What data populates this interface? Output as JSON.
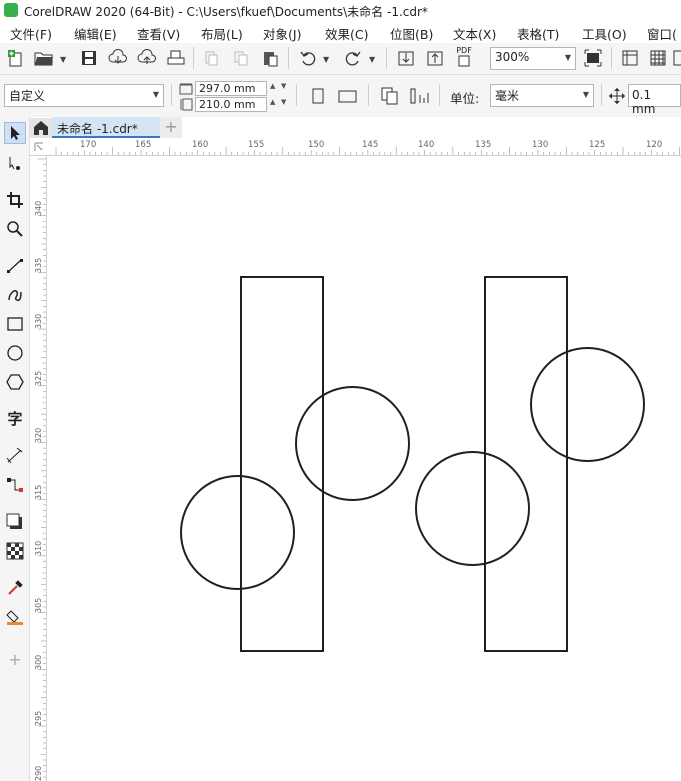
{
  "app": {
    "title": "CorelDRAW 2020 (64-Bit) - C:\\Users\\fkuef\\Documents\\未命名 -1.cdr*"
  },
  "menu": [
    "文件(F)",
    "编辑(E)",
    "查看(V)",
    "布局(L)",
    "对象(J)",
    "效果(C)",
    "位图(B)",
    "文本(X)",
    "表格(T)",
    "工具(O)",
    "窗口("
  ],
  "toolbar": {
    "pdf_label": "PDF",
    "zoom_value": "300%"
  },
  "property_bar": {
    "page_preset": "自定义",
    "page_width": "297.0 mm",
    "page_height": "210.0 mm",
    "units_label": "单位:",
    "units_value": "毫米",
    "nudge_value": "0.1 mm"
  },
  "document_tab": {
    "name": "未命名 -1.cdr*"
  },
  "ruler": {
    "horizontal": [
      "170",
      "165",
      "160",
      "155",
      "150",
      "145",
      "140",
      "135",
      "130",
      "125",
      "120"
    ],
    "vertical": [
      "340",
      "335",
      "330",
      "325",
      "320",
      "315",
      "310",
      "305",
      "300",
      "295",
      "290"
    ]
  },
  "toolbox": {
    "text_tool_glyph": "字"
  },
  "colors": {
    "app_icon": "#35b04a",
    "tab_active": "#d4e4f4",
    "tab_accent": "#3a78c2",
    "shape_stroke": "#231f20"
  }
}
